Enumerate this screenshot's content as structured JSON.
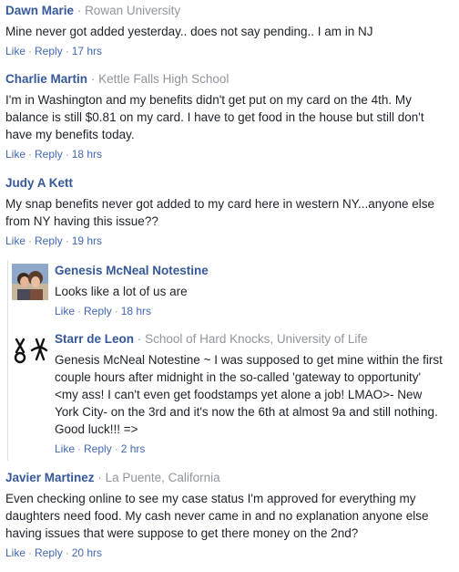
{
  "comments": [
    {
      "author": "Dawn Marie",
      "affiliation": "Rowan University",
      "text": "Mine never got added yesterday.. does not say pending.. I am in NJ",
      "like": "Like",
      "reply": "Reply",
      "time": "17 hrs"
    },
    {
      "author": "Charlie Martin",
      "affiliation": "Kettle Falls High School",
      "text": "I'm in Washington and my benefits didn't get put on my card on the 4th. My balance is still $0.81 on my card. I have to get food in the house but still don't have my benefits today.",
      "like": "Like",
      "reply": "Reply",
      "time": "18 hrs"
    },
    {
      "author": "Judy A Kett",
      "affiliation": "",
      "text": "My snap benefits never got added to my card here in western NY...anyone else from NY having this issue??",
      "like": "Like",
      "reply": "Reply",
      "time": "19 hrs"
    },
    {
      "author": "Genesis McNeal Notestine",
      "affiliation": "",
      "text": "Looks like a lot of us are",
      "like": "Like",
      "reply": "Reply",
      "time": "18 hrs",
      "avatar": "couple-photo"
    },
    {
      "author": "Starr de Leon",
      "affiliation": "School of Hard Knocks, University of Life",
      "text": "Genesis McNeal Notestine ~ I was supposed to get mine within the first couple hours after midnight in the so-called 'gateway to opportunity' <my ass! I can't even get foodstamps yet alone a job! LMAO>- New York City- on the 3rd and it's now the 6th at almost 9a and still nothing. Good luck!!! =>",
      "like": "Like",
      "reply": "Reply",
      "time": "2 hrs",
      "avatar": "symbol-logo"
    },
    {
      "author": "Javier Martinez",
      "affiliation": "La Puente, California",
      "text": "Even checking online to see my case status I'm approved for everything my daughters need food. My cash never came in and no explanation anyone else having issues that were suppose to get there money on the 2nd?",
      "like": "Like",
      "reply": "Reply",
      "time": "20 hrs"
    }
  ],
  "separator": "·",
  "colors": {
    "author": "#365899",
    "link": "#4267b2",
    "muted": "#90949c",
    "text": "#1d2129"
  }
}
